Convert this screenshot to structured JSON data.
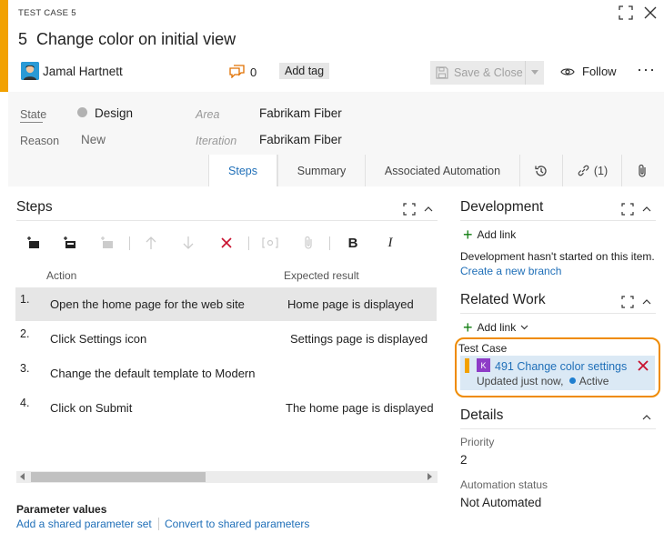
{
  "header": {
    "type_label": "TEST CASE 5",
    "id": "5",
    "title": "Change color on initial view",
    "owner": "Jamal Hartnett",
    "comment_count": "0",
    "add_tag": "Add tag",
    "save_close": "Save & Close",
    "follow": "Follow",
    "more": "···"
  },
  "fields": {
    "state_label": "State",
    "state_value": "Design",
    "reason_label": "Reason",
    "reason_value": "New",
    "area_label": "Area",
    "area_value": "Fabrikam Fiber",
    "iteration_label": "Iteration",
    "iteration_value": "Fabrikam Fiber"
  },
  "tabs": {
    "steps": "Steps",
    "summary": "Summary",
    "automation": "Associated Automation",
    "links": "(1)"
  },
  "steps": {
    "title": "Steps",
    "col_action": "Action",
    "col_expected": "Expected result",
    "rows": [
      {
        "num": "1.",
        "action": "Open the home page for the web site",
        "expected": "Home page is displayed"
      },
      {
        "num": "2.",
        "action": "Click Settings icon",
        "expected": "Settings page is displayed"
      },
      {
        "num": "3.",
        "action": "Change the default template to Modern",
        "expected": ""
      },
      {
        "num": "4.",
        "action": "Click on Submit",
        "expected": "The home page is displayed"
      }
    ],
    "toolbar_bold": "B",
    "toolbar_italic": "I"
  },
  "parameters": {
    "title": "Parameter values",
    "add_shared": "Add a shared parameter set",
    "convert": "Convert to shared parameters"
  },
  "development": {
    "title": "Development",
    "add_link": "Add link",
    "message": "Development hasn't started on this item.",
    "create_branch": "Create a new branch"
  },
  "related": {
    "title": "Related Work",
    "add_link": "Add link",
    "group_label": "Test Case",
    "item_icon_letter": "K",
    "item_id": "491",
    "item_title": "Change color settings",
    "item_updated": "Updated just now,",
    "item_state": "Active"
  },
  "details": {
    "title": "Details",
    "priority_label": "Priority",
    "priority_value": "2",
    "automation_label": "Automation status",
    "automation_value": "Not Automated"
  },
  "colors": {
    "accent": "#f2a100",
    "link": "#1f6fb8",
    "highlight": "#ef8b00",
    "delete": "#c8102e"
  }
}
